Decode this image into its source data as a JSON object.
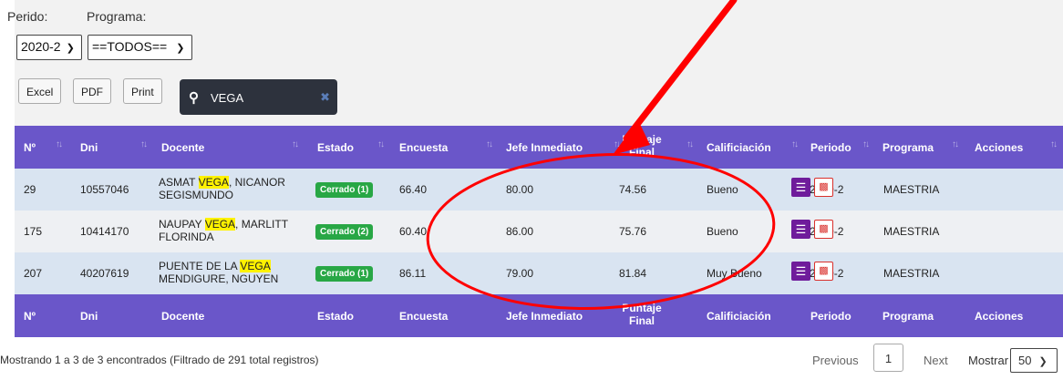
{
  "filters": {
    "periodo_label": "Perido:",
    "programa_label": "Programa:",
    "periodo_value": "2020-2",
    "programa_value": "==TODOS=="
  },
  "export": {
    "excel": "Excel",
    "pdf": "PDF",
    "print": "Print"
  },
  "search": {
    "value": "VEGA"
  },
  "columns": [
    "Nº",
    "Dni",
    "Docente",
    "Estado",
    "Encuesta",
    "Jefe Inmediato",
    "Puntaje Final",
    "Calificiación",
    "Periodo",
    "Programa",
    "Acciones"
  ],
  "column_parts": {
    "puntaje_a": "Puntaje",
    "puntaje_b": "Final"
  },
  "rows": [
    {
      "n": "29",
      "dni": "10557046",
      "doc_pre": "ASMAT ",
      "doc_hl": "VEGA",
      "doc_post": ", NICANOR",
      "doc_line2": "SEGISMUNDO",
      "estado": "Cerrado (1)",
      "encuesta": "66.40",
      "jefe": "80.00",
      "puntaje": "74.56",
      "calificacion": "Bueno",
      "periodo": "2020-2",
      "programa": "MAESTRIA"
    },
    {
      "n": "175",
      "dni": "10414170",
      "doc_pre": "NAUPAY ",
      "doc_hl": "VEGA",
      "doc_post": ", MARLITT",
      "doc_line2": "FLORINDA",
      "estado": "Cerrado (2)",
      "encuesta": "60.40",
      "jefe": "86.00",
      "puntaje": "75.76",
      "calificacion": "Bueno",
      "periodo": "2020-2",
      "programa": "MAESTRIA"
    },
    {
      "n": "207",
      "dni": "40207619",
      "doc_pre": "PUENTE DE LA ",
      "doc_hl": "VEGA",
      "doc_post": "",
      "doc_line2": "MENDIGURE, NGUYEN",
      "estado": "Cerrado (1)",
      "encuesta": "86.11",
      "jefe": "79.00",
      "puntaje": "81.84",
      "calificacion": "Muy Bueno",
      "periodo": "2020-2",
      "programa": "MAESTRIA"
    }
  ],
  "footer": {
    "info": "Mostrando 1 a 3 de 3 encontrados (Filtrado de 291 total registros)",
    "previous": "Previous",
    "page": "1",
    "next": "Next",
    "mostrar": "Mostrar",
    "page_size": "50"
  },
  "colors": {
    "header_bg": "#6a56c9",
    "row_odd": "#d9e4f1",
    "row_even": "#eef0f3",
    "badge": "#28a745",
    "annotation": "#ff0000",
    "highlight": "#fff200"
  },
  "icons": [
    "search-icon",
    "clear-icon",
    "sort-icon",
    "list-icon",
    "pdf-icon",
    "chevron-down-icon"
  ]
}
